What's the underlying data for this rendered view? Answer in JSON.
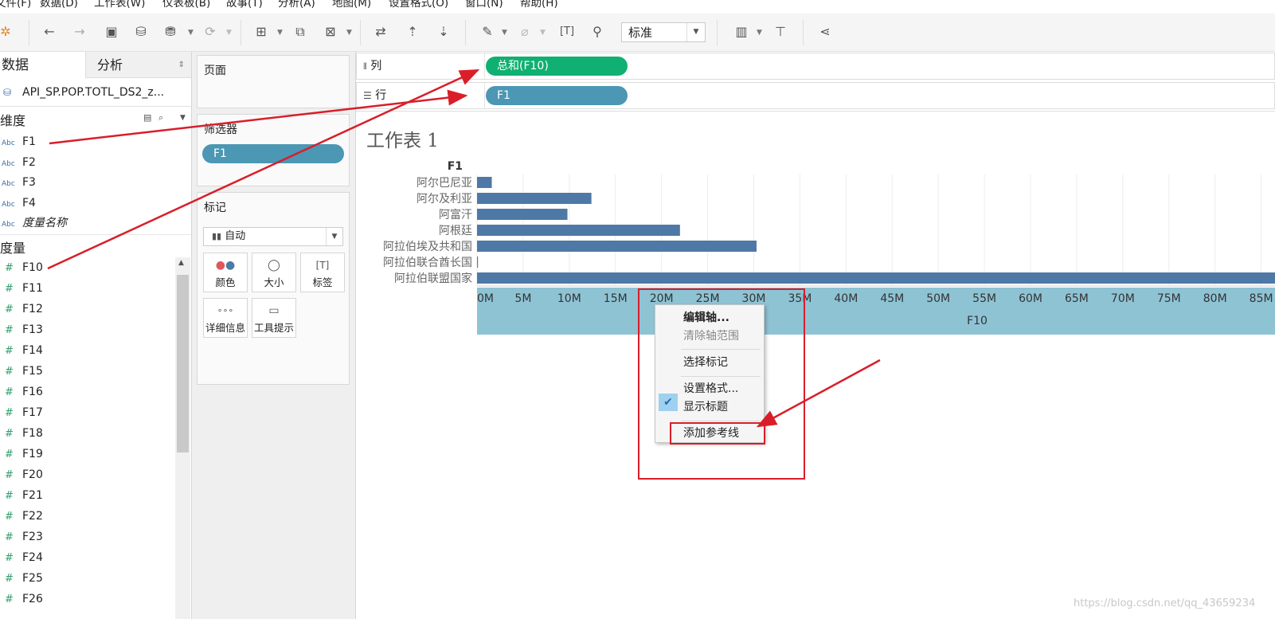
{
  "menubar": [
    "文件(F)",
    "数据(D)",
    "工作表(W)",
    "仪表板(B)",
    "故事(T)",
    "分析(A)",
    "地图(M)",
    "设置格式(O)",
    "窗口(N)",
    "帮助(H)"
  ],
  "toolbar": {
    "view_mode": "标准"
  },
  "left": {
    "tab_data": "数据",
    "tab_analysis": "分析",
    "datasource": "API_SP.POP.TOTL_DS2_z...",
    "dimensions_header": "维度",
    "dimensions": [
      "F1",
      "F2",
      "F3",
      "F4",
      "度量名称"
    ],
    "measures_header": "度量",
    "measures": [
      "F10",
      "F11",
      "F12",
      "F13",
      "F14",
      "F15",
      "F16",
      "F17",
      "F18",
      "F19",
      "F20",
      "F21",
      "F22",
      "F23",
      "F24",
      "F25",
      "F26"
    ]
  },
  "cards": {
    "pages": "页面",
    "filters": "筛选器",
    "filter_pill": "F1",
    "marks": "标记",
    "mark_type": "自动",
    "buttons": [
      "颜色",
      "大小",
      "标签",
      "详细信息",
      "工具提示"
    ]
  },
  "shelves": {
    "columns_label": "列",
    "columns_pill": "总和(F10)",
    "rows_label": "行",
    "rows_pill": "F1"
  },
  "worksheet": {
    "title": "工作表 1"
  },
  "chart_data": {
    "type": "bar",
    "orientation": "horizontal",
    "title": "",
    "category_header": "F1",
    "xlabel": "F10",
    "categories": [
      "阿尔巴尼亚",
      "阿尔及利亚",
      "阿富汗",
      "阿根廷",
      "阿拉伯埃及共和国",
      "阿拉伯联合酋长国",
      "阿拉伯联盟国家"
    ],
    "values": [
      1.6,
      12.4,
      9.8,
      22.0,
      30.3,
      0.1,
      87.0
    ],
    "value_unit": "M",
    "xticks": [
      "0M",
      "5M",
      "10M",
      "15M",
      "20M",
      "25M",
      "30M",
      "35M",
      "40M",
      "45M",
      "50M",
      "55M",
      "60M",
      "65M",
      "70M",
      "75M",
      "80M",
      "85M"
    ],
    "xlim": [
      0,
      86.5
    ],
    "grid": true,
    "bar_color": "#4e79a7"
  },
  "context_menu": {
    "items": [
      "编辑轴...",
      "清除轴范围",
      "选择标记",
      "设置格式...",
      "显示标题",
      "添加参考线"
    ],
    "checked": "显示标题",
    "highlighted": "添加参考线"
  },
  "watermark": "https://blog.csdn.net/qq_43659234"
}
